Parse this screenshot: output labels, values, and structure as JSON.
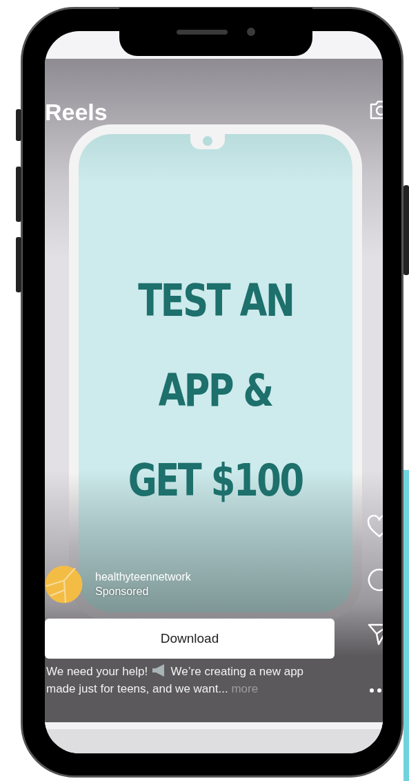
{
  "screen": {
    "title": "Reels",
    "headline": [
      "TEST AN",
      "APP &",
      "GET $100"
    ],
    "account": {
      "name": "healthyteennetwork",
      "label": "Sponsored"
    },
    "button": "Download",
    "caption": {
      "text_before": "We need your help!",
      "text_after": "We’re creating a new app made just for teens, and we want...",
      "more": "more"
    }
  }
}
